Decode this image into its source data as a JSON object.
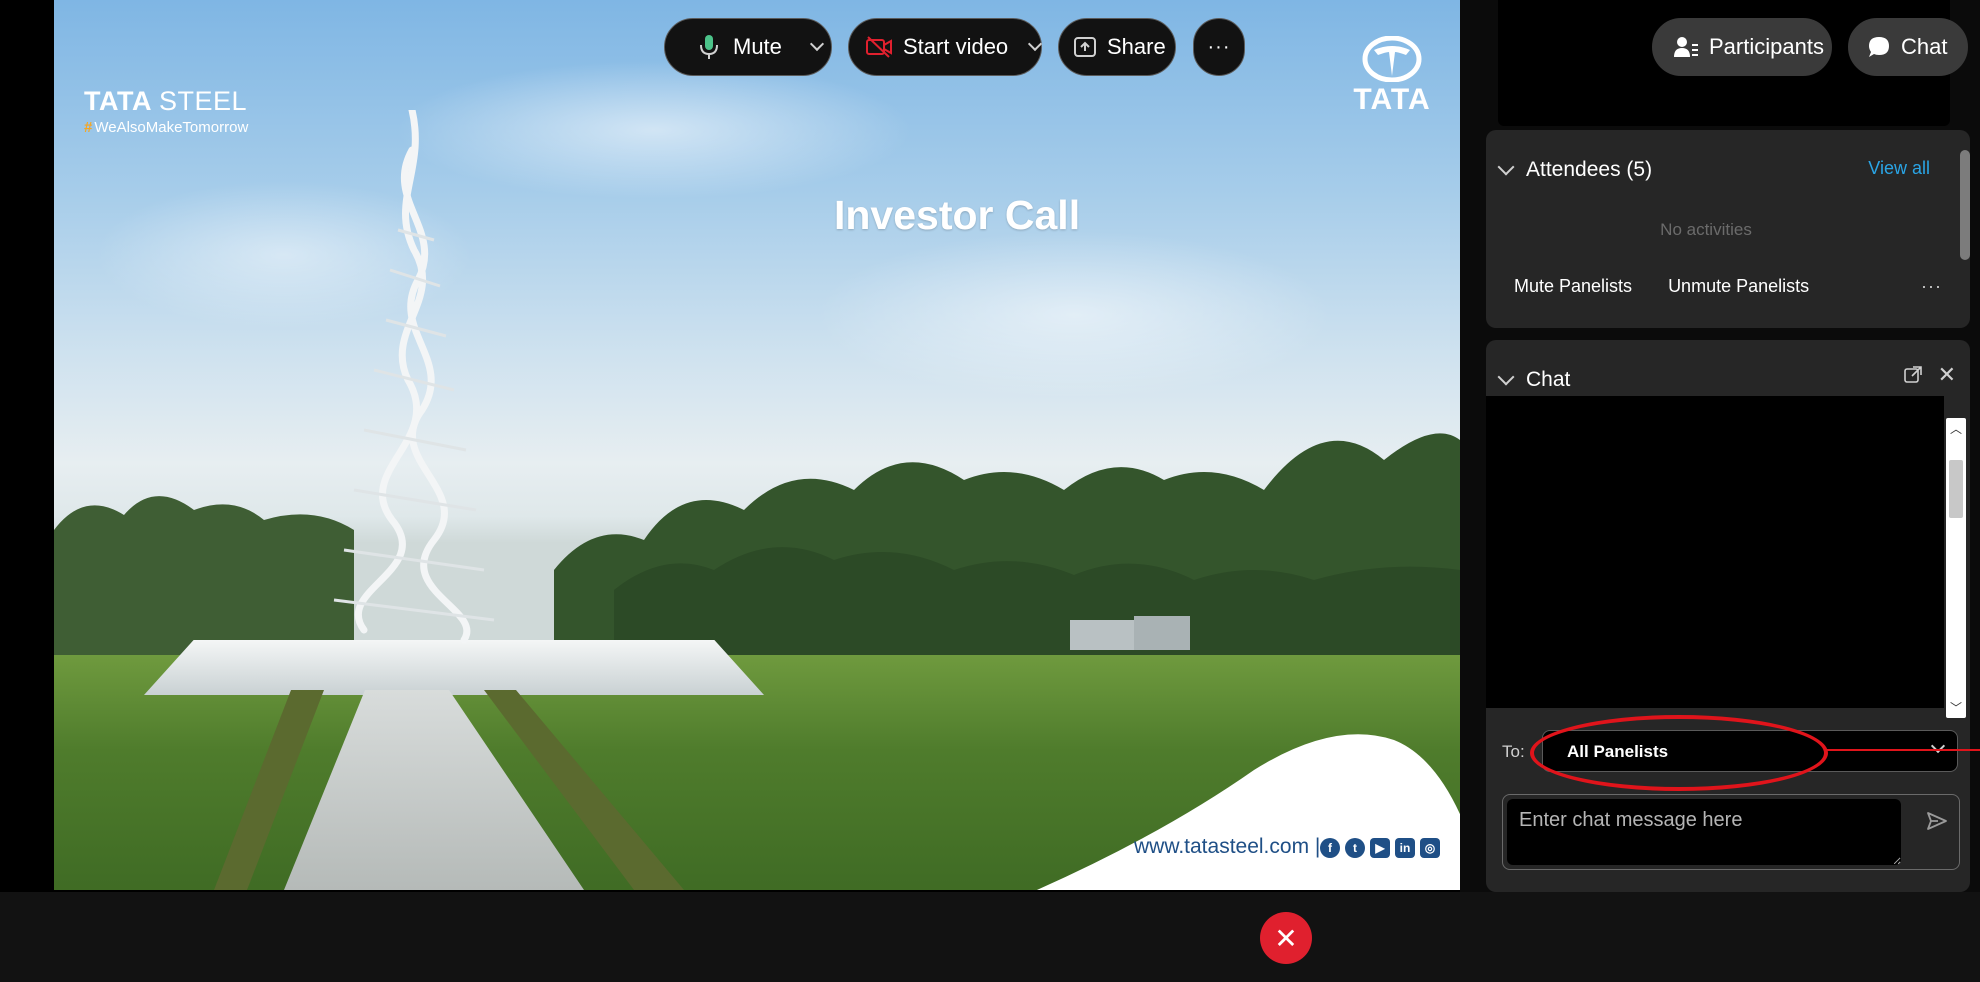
{
  "slide": {
    "brand_wordmark_bold": "TATA",
    "brand_wordmark_light": "STEEL",
    "brand_hash": "#",
    "brand_tagline": "WeAlsoMakeTomorrow",
    "logo_name": "TATA",
    "title": "Investor Call",
    "url": "www.tatasteel.com |",
    "social_icons": [
      "facebook-icon",
      "twitter-icon",
      "youtube-icon",
      "linkedin-icon",
      "instagram-icon"
    ]
  },
  "attendees": {
    "title": "Attendees (5)",
    "view_all": "View all",
    "empty_state": "No activities",
    "mute_panelists": "Mute Panelists",
    "unmute_panelists": "Unmute Panelists",
    "more": "···"
  },
  "chat": {
    "title": "Chat",
    "to_label": "To:",
    "to_value": "All Panelists",
    "input_placeholder": "Enter chat message here",
    "close_glyph": "✕",
    "scroll_up": "︿",
    "scroll_down": "﹀"
  },
  "toolbar": {
    "mute": "Mute",
    "start_video": "Start video",
    "share": "Share",
    "more": "···",
    "leave_glyph": "✕",
    "participants": "Participants",
    "chat": "Chat"
  },
  "colors": {
    "accent_link": "#2aa5e6",
    "leave_red": "#e0202e",
    "annotation_red": "#e0141b",
    "panel_card": "#262626",
    "tata_blue": "#1f4f86"
  }
}
